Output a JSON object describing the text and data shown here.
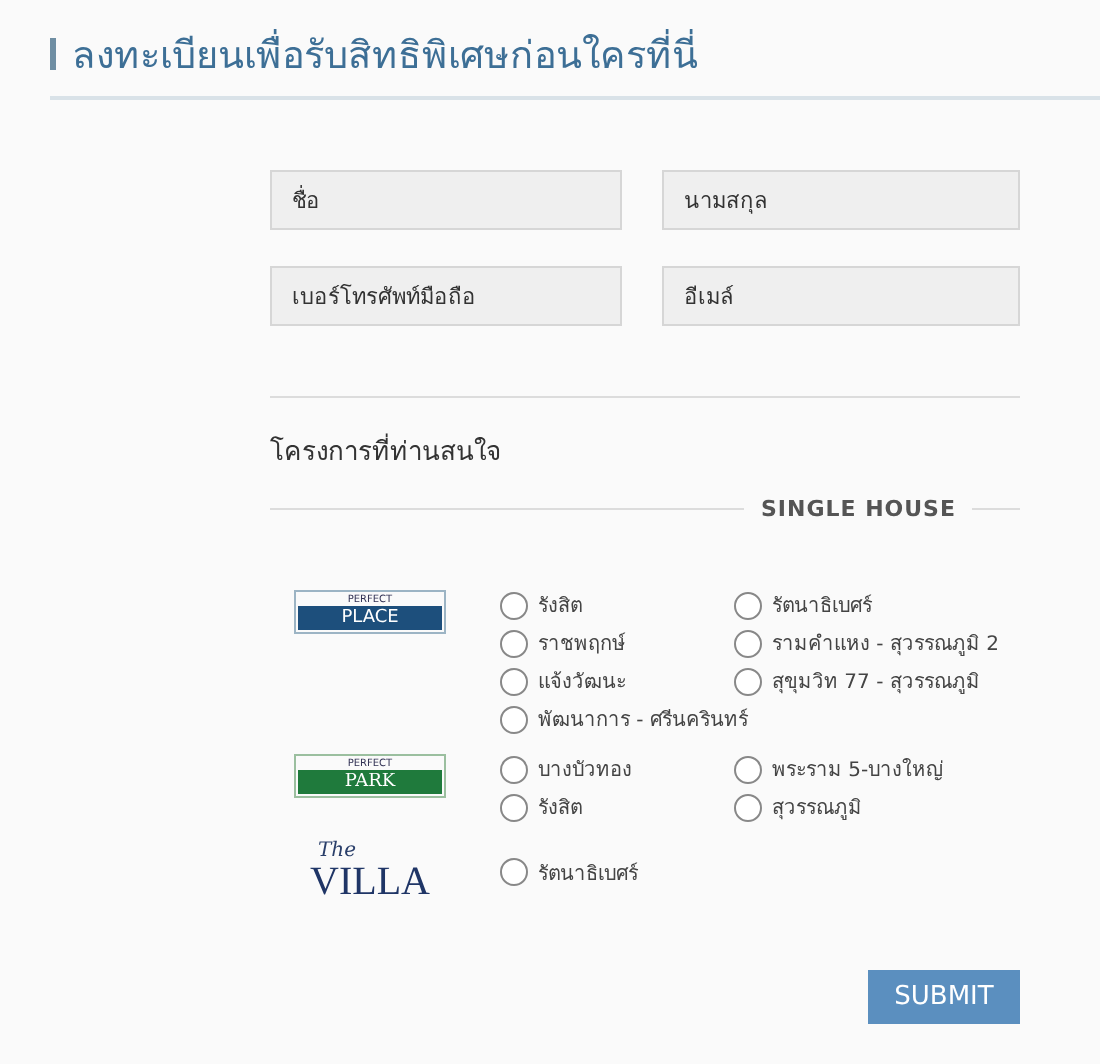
{
  "title": "ลงทะเบียนเพื่อรับสิทธิพิเศษก่อนใครที่นี่",
  "fields": [
    {
      "placeholder": "ชื่อ"
    },
    {
      "placeholder": "นามสกุล"
    },
    {
      "placeholder": "เบอร์โทรศัพท์มือถือ"
    },
    {
      "placeholder": "อีเมล์"
    }
  ],
  "projects_label": "โครงการที่ท่านสนใจ",
  "section": "SINGLE HOUSE",
  "groups": [
    {
      "logo": {
        "kind": "place",
        "small": "PERFECT",
        "main": "PLACE"
      },
      "options": [
        {
          "label": "รังสิต",
          "selected": false
        },
        {
          "label": "รัตนาธิเบศร์",
          "selected": false
        },
        {
          "label": "ราชพฤกษ์",
          "selected": false
        },
        {
          "label": "รามคำแหง - สุวรรณภูมิ 2",
          "selected": false
        },
        {
          "label": "แจ้งวัฒนะ",
          "selected": false
        },
        {
          "label": "สุขุมวิท 77 - สุวรรณภูมิ",
          "selected": false
        },
        {
          "label": "พัฒนาการ - ศรีนครินทร์",
          "selected": false
        }
      ]
    },
    {
      "logo": {
        "kind": "park",
        "small": "PERFECT",
        "main": "PARK"
      },
      "options": [
        {
          "label": "บางบัวทอง",
          "selected": false
        },
        {
          "label": "พระราม 5-บางใหญ่",
          "selected": false
        },
        {
          "label": "รังสิต",
          "selected": false
        },
        {
          "label": "สุวรรณภูมิ",
          "selected": false
        }
      ]
    },
    {
      "logo": {
        "kind": "villa",
        "small": "The",
        "main": "VILLA"
      },
      "options": [
        {
          "label": "รัตนาธิเบศร์",
          "selected": false
        }
      ]
    }
  ],
  "submit": "SUBMIT"
}
